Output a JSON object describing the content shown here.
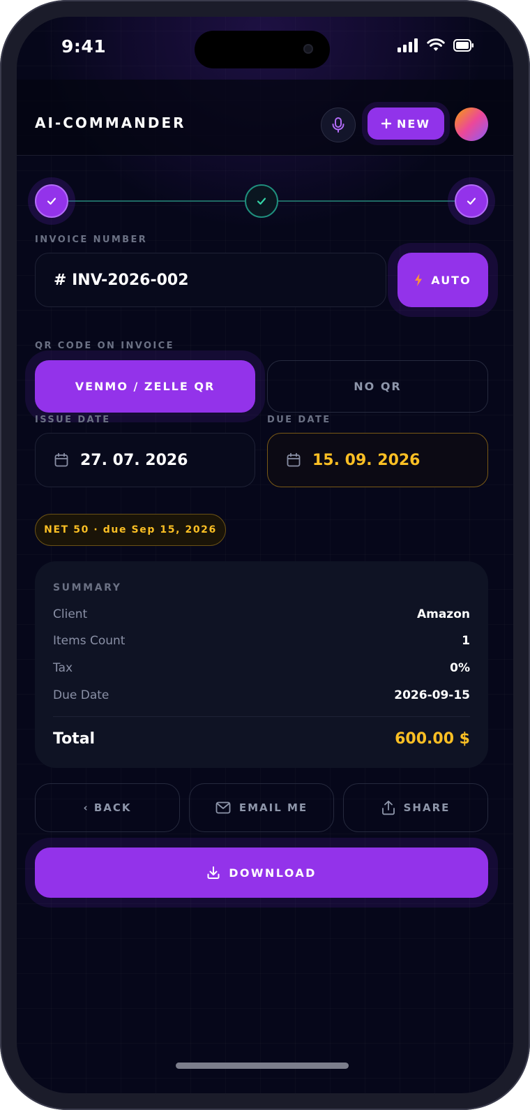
{
  "status_bar": {
    "time": "9:41"
  },
  "header": {
    "brand": "AI-COMMANDER",
    "new_button_label": "NEW"
  },
  "stepper": {
    "steps": [
      "done",
      "active",
      "done"
    ]
  },
  "invoice": {
    "number_label": "INVOICE NUMBER",
    "number_value": "# INV-2026-002",
    "auto_button_label": "AUTO"
  },
  "qr": {
    "label": "QR CODE ON INVOICE",
    "options": [
      "VENMO / ZELLE QR",
      "NO QR"
    ],
    "selected": "VENMO / ZELLE QR"
  },
  "dates": {
    "issue_label": "ISSUE DATE",
    "issue_value": "27. 07. 2026",
    "due_label": "DUE DATE",
    "due_value": "15. 09. 2026"
  },
  "terms_pill": "NET 50 · due Sep 15, 2026",
  "summary": {
    "title": "SUMMARY",
    "rows": [
      {
        "key": "Client",
        "value": "Amazon"
      },
      {
        "key": "Items Count",
        "value": "1"
      },
      {
        "key": "Tax",
        "value": "0%"
      },
      {
        "key": "Due Date",
        "value": "2026-09-15"
      }
    ],
    "total_label": "Total",
    "total_value": "600.00 $"
  },
  "actions": {
    "back_label": "‹ BACK",
    "email_label": "EMAIL ME",
    "share_label": "SHARE",
    "download_label": "DOWNLOAD"
  },
  "colors": {
    "accent": "#9333ea",
    "warning": "#fbbf24",
    "success": "#1f8f7d",
    "background": "#06071a"
  }
}
